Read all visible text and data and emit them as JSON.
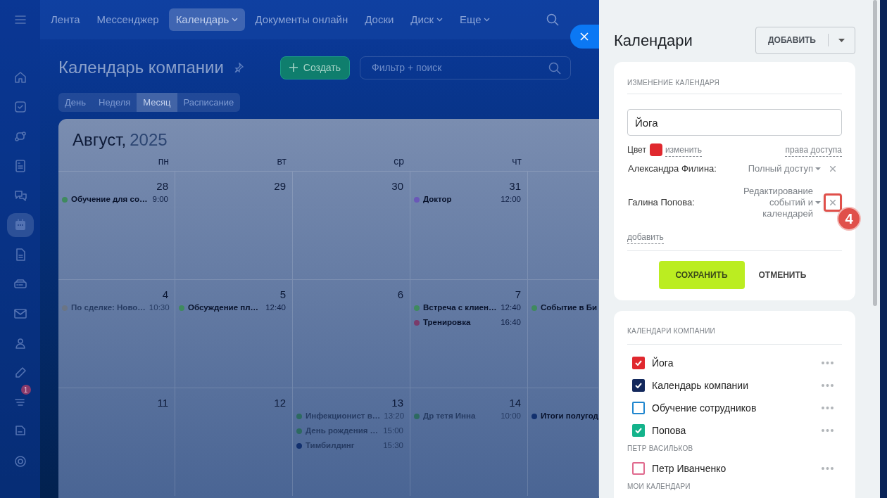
{
  "top_nav": {
    "items": [
      {
        "label": "Лента",
        "selected": false,
        "dropdown": false
      },
      {
        "label": "Мессенджер",
        "selected": false,
        "dropdown": false
      },
      {
        "label": "Календарь",
        "selected": true,
        "dropdown": true
      },
      {
        "label": "Документы онлайн",
        "selected": false,
        "dropdown": false
      },
      {
        "label": "Доски",
        "selected": false,
        "dropdown": false
      },
      {
        "label": "Диск",
        "selected": false,
        "dropdown": true
      },
      {
        "label": "Еще",
        "selected": false,
        "dropdown": true
      }
    ]
  },
  "sidebar": {
    "items": [
      {
        "selected": false
      },
      {
        "selected": false
      },
      {
        "selected": false
      },
      {
        "selected": false
      },
      {
        "selected": false
      },
      {
        "selected": true
      },
      {
        "selected": false
      },
      {
        "selected": false
      },
      {
        "selected": false
      },
      {
        "selected": false
      },
      {
        "selected": false
      },
      {
        "selected": false,
        "badge": "1"
      },
      {
        "selected": false
      },
      {
        "selected": false
      }
    ]
  },
  "page": {
    "title": "Календарь компании",
    "create_button": "Создать",
    "search": {
      "placeholder": "Фильтр + поиск"
    },
    "views": [
      {
        "label": "День",
        "selected": false
      },
      {
        "label": "Неделя",
        "selected": false
      },
      {
        "label": "Месяц",
        "selected": true
      },
      {
        "label": "Расписание",
        "selected": false
      }
    ]
  },
  "calendar": {
    "month": "Август,",
    "year": "2025",
    "weekdays": [
      "пн",
      "вт",
      "ср",
      "чт"
    ],
    "weeks": [
      {
        "days": [
          {
            "date": "28",
            "events": [
              {
                "title": "Обучение для со…",
                "time": "9:00",
                "color": "#3f8a5e",
                "faded": false
              }
            ]
          },
          {
            "date": "29"
          },
          {
            "date": "30"
          },
          {
            "date": "31",
            "events": [
              {
                "title": "Доктор",
                "time": "12:00",
                "color": "#6a58b8",
                "faded": false
              }
            ]
          }
        ]
      },
      {
        "days": [
          {
            "date": "4",
            "events": [
              {
                "title": "По сделке: Ново…",
                "time": "10:30",
                "color": "#6b7585",
                "faded": true
              }
            ]
          },
          {
            "date": "5",
            "events": [
              {
                "title": "Обсуждение пл…",
                "time": "12:40",
                "color": "#3f8a5e",
                "faded": false
              }
            ]
          },
          {
            "date": "6"
          },
          {
            "date": "7",
            "events": [
              {
                "title": "Встреча с клиен…",
                "time": "12:40",
                "color": "#3f8a5e",
                "faded": false
              },
              {
                "title": "Тренировка",
                "time": "16:40",
                "color": "#7a3b6a",
                "faded": false
              }
            ]
          },
          {
            "events": [
              {
                "title": "Событие в Би",
                "color": "#3f8a5e",
                "faded": false
              }
            ]
          }
        ]
      },
      {
        "days": [
          {
            "date": "11"
          },
          {
            "date": "12"
          },
          {
            "date": "13",
            "events": [
              {
                "title": "Инфекционист в…",
                "time": "13:20",
                "color": "#2d6a60",
                "faded": true
              },
              {
                "title": "День рождения …",
                "time": "15:00",
                "color": "#2d6a60",
                "faded": true
              },
              {
                "title": "Тимбилдинг",
                "time": "15:30",
                "color": "#12306e",
                "faded": true
              }
            ]
          },
          {
            "date": "14",
            "events": [
              {
                "title": "Др тетя Инна",
                "time": "10:00",
                "color": "#2d6a60",
                "faded": true
              }
            ]
          },
          {
            "events": [
              {
                "title": "Итоги полугод",
                "color": "#12306e",
                "faded": false
              }
            ]
          }
        ]
      }
    ]
  },
  "panel": {
    "title": "Календари",
    "add_button": "ДОБАВИТЬ",
    "edit_card": {
      "heading": "ИЗМЕНЕНИЕ КАЛЕНДАРЯ",
      "name_value": "Йога",
      "color_label": "Цвет",
      "color": "#e0282e",
      "change_link": "изменить",
      "access_link": "права доступа",
      "access": [
        {
          "person": "Александра Филина:",
          "level": "Полный доступ",
          "highlighted": false
        },
        {
          "person": "Галина Попова:",
          "level": "Редактирование событий и календарей",
          "highlighted": true
        }
      ],
      "annotation": "4",
      "add_link": "добавить",
      "save_button": "СОХРАНИТЬ",
      "cancel_button": "ОТМЕНИТЬ"
    },
    "list_card": {
      "groups": [
        {
          "heading": "КАЛЕНДАРИ КОМПАНИИ",
          "items": [
            {
              "label": "Йога",
              "checked": true,
              "color": "#e0282e"
            },
            {
              "label": "Календарь компании",
              "checked": true,
              "color": "#13285c"
            },
            {
              "label": "Обучение сотрудников",
              "checked": false,
              "color": "#1f86cf"
            },
            {
              "label": "Попова",
              "checked": true,
              "color": "#14b38b"
            }
          ]
        },
        {
          "heading": "ПЕТР ВАСИЛЬКОВ",
          "items": [
            {
              "label": "Петр Иванченко",
              "checked": false,
              "color": "#e06a8e"
            }
          ]
        },
        {
          "heading": "МОИ КАЛЕНДАРИ"
        }
      ]
    }
  }
}
